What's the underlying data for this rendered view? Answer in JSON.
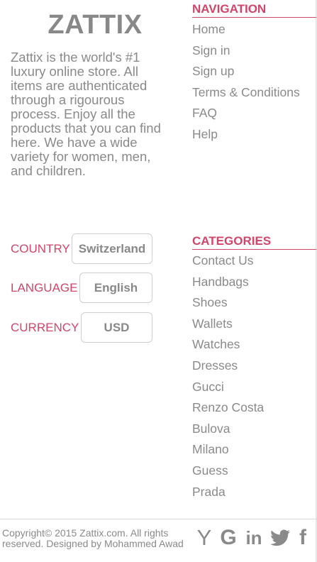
{
  "brand": {
    "name": "ZATTIX"
  },
  "about": {
    "text": "Zattix is the world's #1 luxury online store. All items are authenticated through a rigourous process. Enjoy all the products that you can find here. We have a wide variety for women, men, and children."
  },
  "settings": {
    "country": {
      "label": "COUNTRY",
      "value": "Switzerland"
    },
    "language": {
      "label": "LANGUAGE",
      "value": "English"
    },
    "currency": {
      "label": "CURRENCY",
      "value": "USD"
    }
  },
  "navigation": {
    "title": "NAVIGATION",
    "items": [
      "Home",
      "Sign in",
      "Sign up",
      "Terms & Conditions",
      "FAQ",
      "Help"
    ]
  },
  "categories": {
    "title": "CATEGORIES",
    "items": [
      "Contact Us",
      "Handbags",
      "Shoes",
      "Wallets",
      "Watches",
      "Dresses",
      "Gucci",
      "Renzo Costa",
      "Bulova",
      "Milano",
      "Guess",
      "Prada"
    ]
  },
  "footer": {
    "copyright": "Copyright© 2015 Zattix.com. All rights reserved. Designed by Mohammed Awad",
    "social_icons": [
      "hacker-news-icon",
      "google-icon",
      "linkedin-icon",
      "twitter-icon",
      "facebook-icon"
    ],
    "social_glyphs": {
      "hacker_news": "Y",
      "google": "G",
      "linkedin": "in",
      "facebook": "f"
    }
  },
  "colors": {
    "accent": "#d0466a",
    "text": "#8a8a8a",
    "border": "#cfcfcf"
  }
}
